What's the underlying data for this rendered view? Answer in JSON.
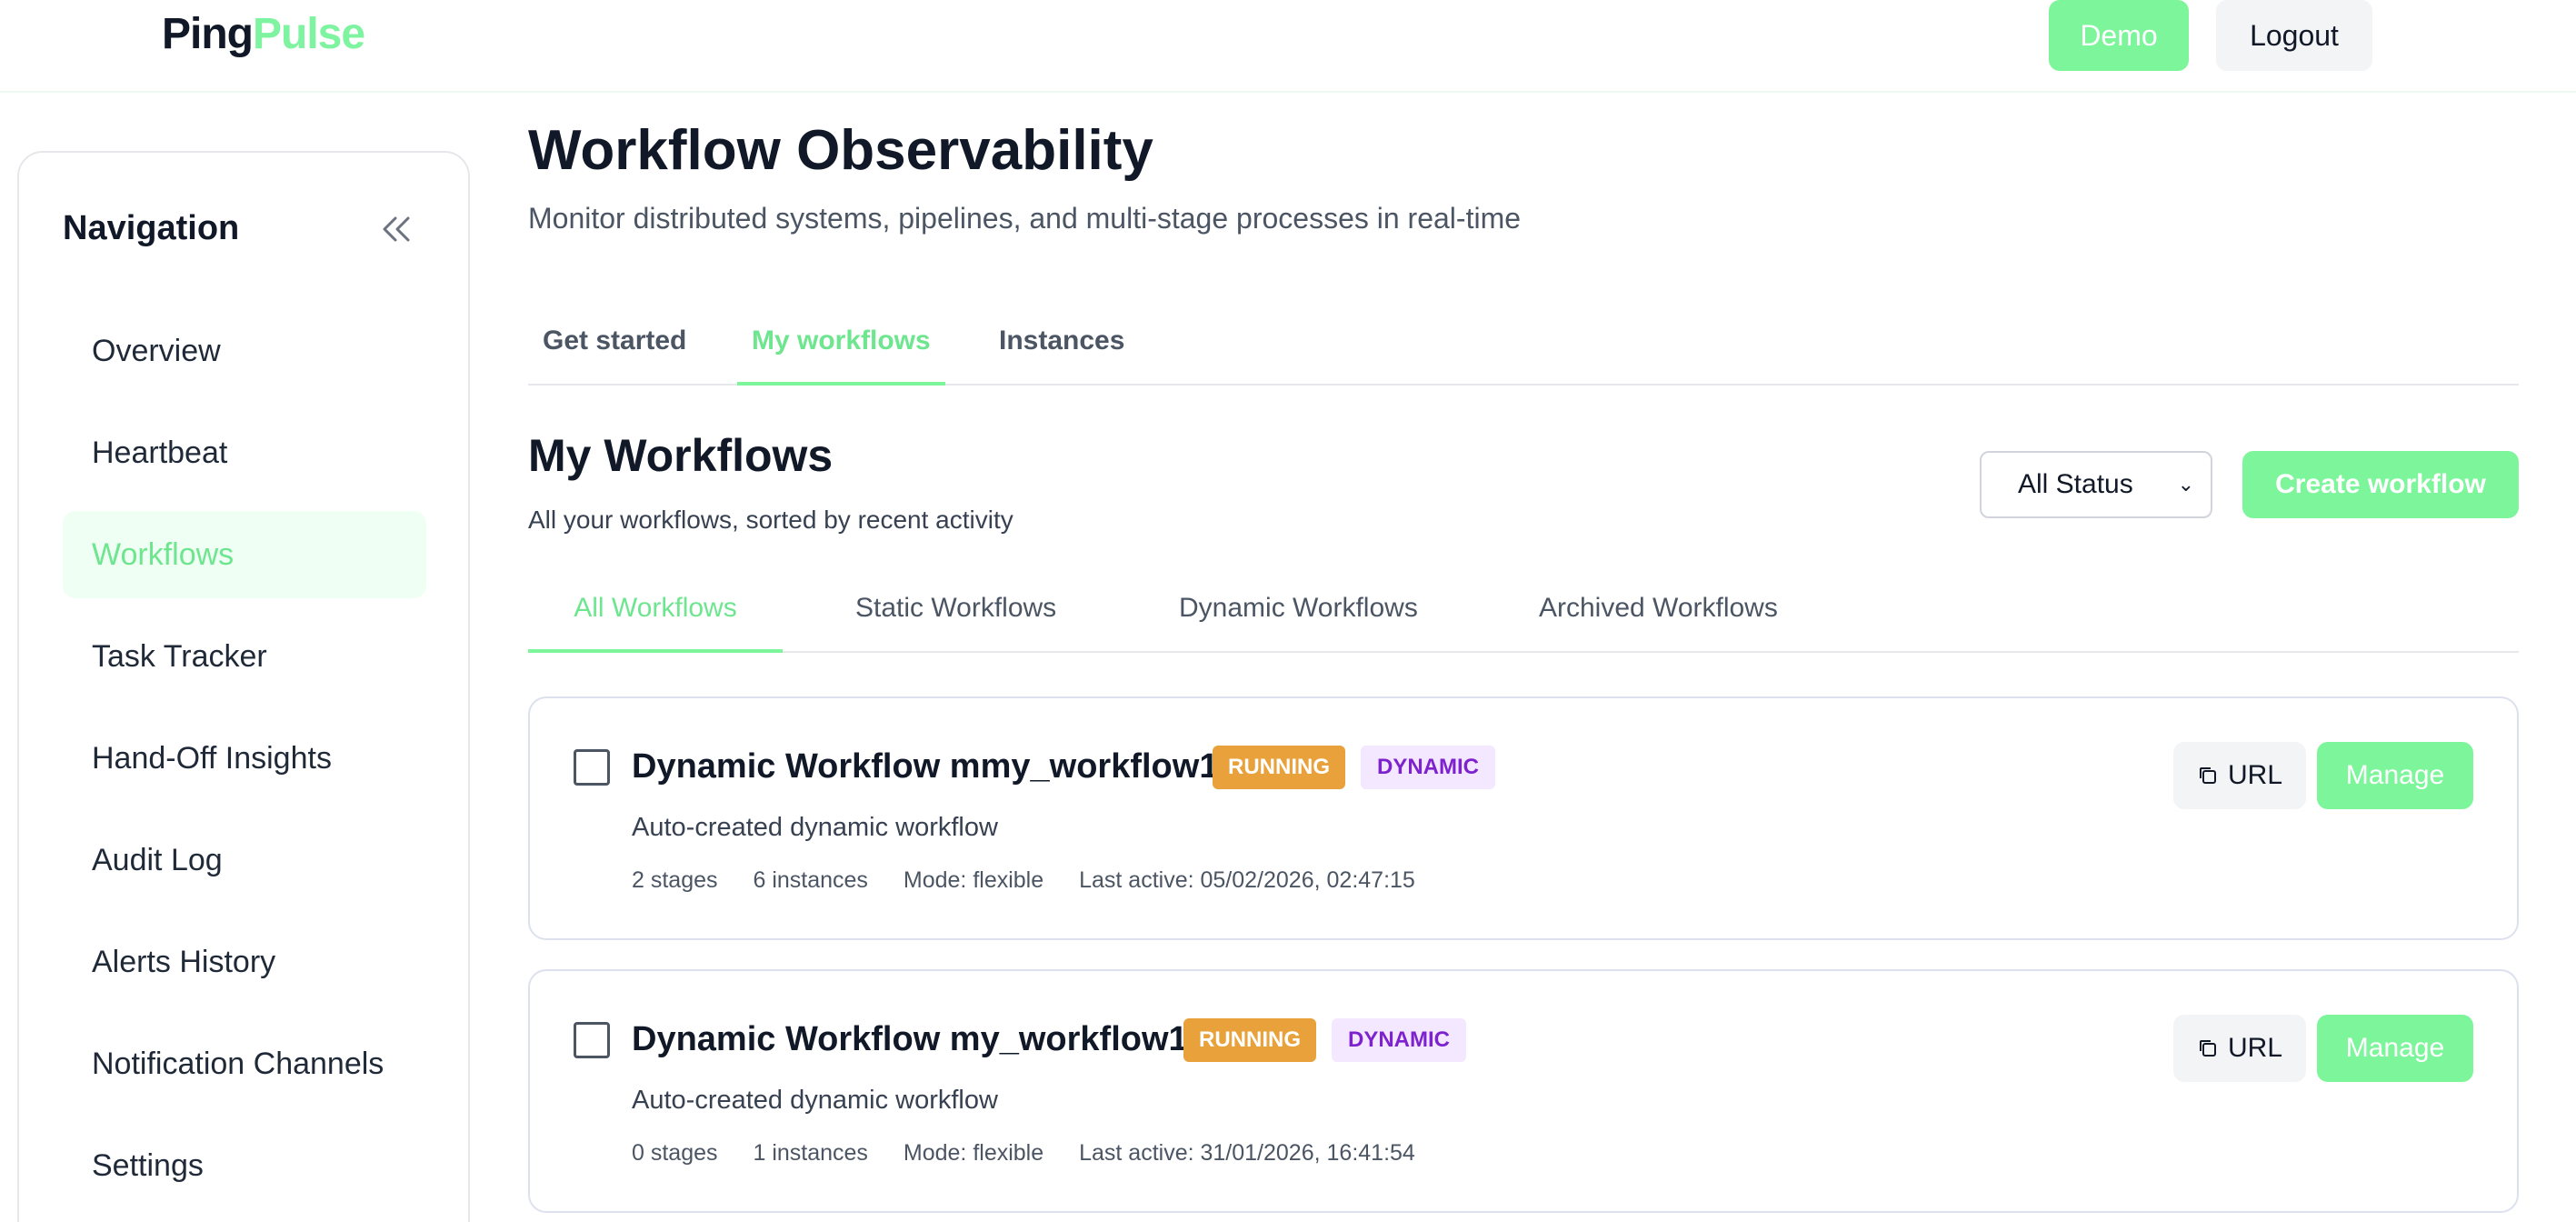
{
  "header": {
    "logo_part1": "Ping",
    "logo_part2": "Pulse",
    "demo_label": "Demo",
    "logout_label": "Logout"
  },
  "sidebar": {
    "title": "Navigation",
    "collapse_icon": "double-chevron-left-icon",
    "items": [
      {
        "label": "Overview",
        "active": false
      },
      {
        "label": "Heartbeat",
        "active": false
      },
      {
        "label": "Workflows",
        "active": true
      },
      {
        "label": "Task Tracker",
        "active": false
      },
      {
        "label": "Hand-Off Insights",
        "active": false
      },
      {
        "label": "Audit Log",
        "active": false
      },
      {
        "label": "Alerts History",
        "active": false
      },
      {
        "label": "Notification Channels",
        "active": false
      },
      {
        "label": "Settings",
        "active": false
      }
    ]
  },
  "main": {
    "title": "Workflow Observability",
    "subtitle": "Monitor distributed systems, pipelines, and multi-stage processes in real-time",
    "tabs": [
      {
        "label": "Get started",
        "active": false
      },
      {
        "label": "My workflows",
        "active": true
      },
      {
        "label": "Instances",
        "active": false
      }
    ],
    "section_title": "My Workflows",
    "section_subtitle": "All your workflows, sorted by recent activity",
    "status_filter": {
      "selected": "All Status"
    },
    "create_label": "Create workflow",
    "subtabs": [
      {
        "label": "All Workflows",
        "active": true
      },
      {
        "label": "Static Workflows",
        "active": false
      },
      {
        "label": "Dynamic Workflows",
        "active": false
      },
      {
        "label": "Archived Workflows",
        "active": false
      }
    ],
    "workflows": [
      {
        "name": "Dynamic Workflow mmy_workflow1",
        "status": "RUNNING",
        "kind": "DYNAMIC",
        "description": "Auto-created dynamic workflow",
        "stages": "2 stages",
        "instances": "6 instances",
        "mode": "Mode: flexible",
        "last_active": "Last active: 05/02/2026, 02:47:15",
        "url_label": "URL",
        "manage_label": "Manage"
      },
      {
        "name": "Dynamic Workflow my_workflow1",
        "status": "RUNNING",
        "kind": "DYNAMIC",
        "description": "Auto-created dynamic workflow",
        "stages": "0 stages",
        "instances": "1 instances",
        "mode": "Mode: flexible",
        "last_active": "Last active: 31/01/2026, 16:41:54",
        "url_label": "URL",
        "manage_label": "Manage"
      }
    ]
  },
  "colors": {
    "accent": "#7df59b",
    "running": "#e9a23b",
    "dynamic_bg": "#f3e8ff",
    "dynamic_text": "#7e22ce"
  }
}
